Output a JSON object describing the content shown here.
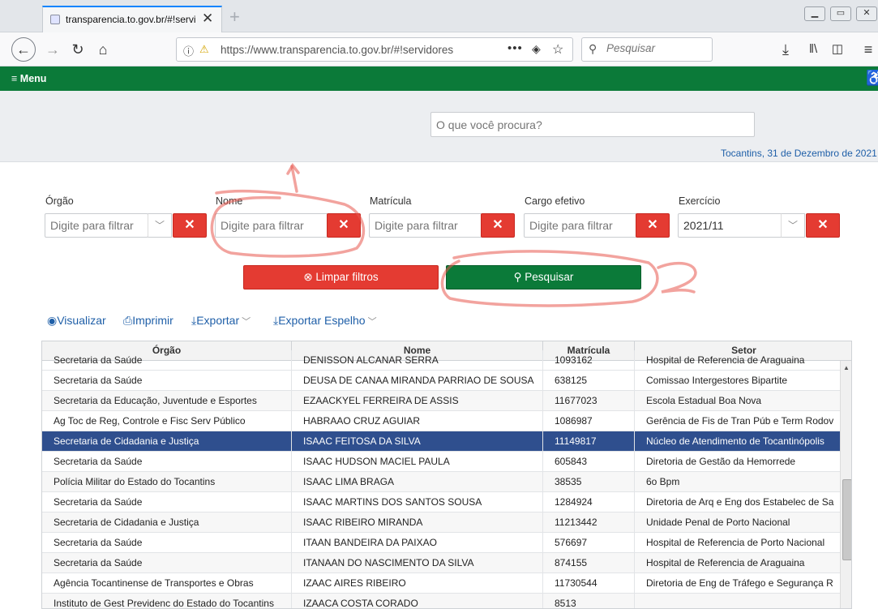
{
  "browser": {
    "tab_title": "transparencia.to.gov.br/#!servic",
    "url": "https://www.transparencia.to.gov.br/#!servidores",
    "search_placeholder": "Pesquisar"
  },
  "site": {
    "menu_label": "Menu",
    "search_placeholder": "O que você procura?",
    "date_line": "Tocantins, 31 de Dezembro de 2021"
  },
  "filters": {
    "orgao": {
      "label": "Órgão",
      "placeholder": "Digite para filtrar"
    },
    "nome": {
      "label": "Nome",
      "placeholder": "Digite para filtrar"
    },
    "matricula": {
      "label": "Matrícula",
      "placeholder": "Digite para filtrar"
    },
    "cargo": {
      "label": "Cargo efetivo",
      "placeholder": "Digite para filtrar"
    },
    "exercicio": {
      "label": "Exercício",
      "value": "2021/11"
    },
    "clear_label": "Limpar filtros",
    "search_label": "Pesquisar"
  },
  "actions": {
    "visualizar": "Visualizar",
    "imprimir": "Imprimir",
    "exportar": "Exportar",
    "exportar_espelho": "Exportar Espelho"
  },
  "table": {
    "columns": [
      "Órgão",
      "Nome",
      "Matrícula",
      "Setor"
    ],
    "partial_row": [
      "Secretaria da Saúde",
      "DENISSON ALCANAR SERRA",
      "1093162",
      "Hospital de Referencia de Araguaina"
    ],
    "rows": [
      [
        "Secretaria da Saúde",
        "DEUSA DE CANAA MIRANDA PARRIAO DE SOUSA",
        "638125",
        "Comissao Intergestores Bipartite"
      ],
      [
        "Secretaria da Educação, Juventude e Esportes",
        "EZAACKYEL FERREIRA DE ASSIS",
        "11677023",
        "Escola Estadual Boa Nova"
      ],
      [
        "Ag Toc de Reg, Controle e Fisc Serv Público",
        "HABRAAO CRUZ AGUIAR",
        "1086987",
        "Gerência de Fis de Tran Púb e Term Rodov"
      ],
      [
        "Secretaria de Cidadania e Justiça",
        "ISAAC FEITOSA DA SILVA",
        "11149817",
        "Núcleo de Atendimento de Tocantinópolis"
      ],
      [
        "Secretaria da Saúde",
        "ISAAC HUDSON MACIEL PAULA",
        "605843",
        "Diretoria de Gestão da Hemorrede"
      ],
      [
        "Polícia Militar do Estado do Tocantins",
        "ISAAC LIMA BRAGA",
        "38535",
        "6o Bpm"
      ],
      [
        "Secretaria da Saúde",
        "ISAAC MARTINS DOS SANTOS SOUSA",
        "1284924",
        "Diretoria de Arq e Eng dos Estabelec de Sa"
      ],
      [
        "Secretaria de Cidadania e Justiça",
        "ISAAC RIBEIRO MIRANDA",
        "11213442",
        "Unidade Penal de Porto Nacional"
      ],
      [
        "Secretaria da Saúde",
        "ITAAN BANDEIRA DA PAIXAO",
        "576697",
        "Hospital de Referencia de Porto Nacional"
      ],
      [
        "Secretaria da Saúde",
        "ITANAAN DO NASCIMENTO DA SILVA",
        "874155",
        "Hospital de Referencia de Araguaina"
      ],
      [
        "Agência Tocantinense de Transportes e Obras",
        "IZAAC AIRES RIBEIRO",
        "11730544",
        "Diretoria de Eng de Tráfego e Segurança R"
      ],
      [
        "Instituto de Gest Previdenc do Estado do Tocantins",
        "IZAACA COSTA CORADO",
        "8513",
        ""
      ]
    ],
    "selected_row_index": 3
  }
}
